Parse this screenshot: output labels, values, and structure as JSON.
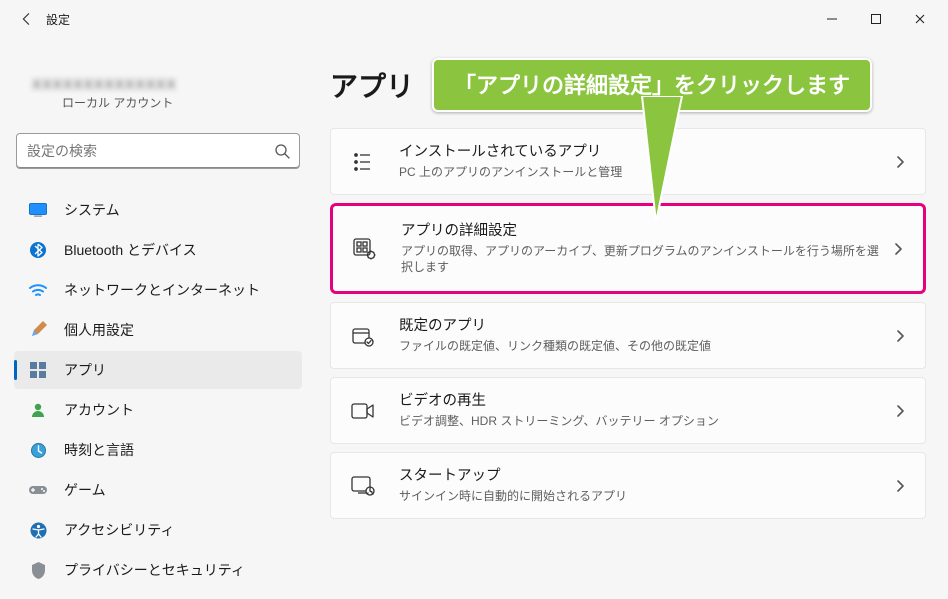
{
  "window": {
    "title": "設定"
  },
  "account": {
    "display_name": "XXXXXXXXXXXXXX",
    "type_label": "ローカル アカウント"
  },
  "search": {
    "placeholder": "設定の検索"
  },
  "sidebar": {
    "items": [
      {
        "label": "システム",
        "icon": "system"
      },
      {
        "label": "Bluetooth とデバイス",
        "icon": "bluetooth"
      },
      {
        "label": "ネットワークとインターネット",
        "icon": "network"
      },
      {
        "label": "個人用設定",
        "icon": "personalize"
      },
      {
        "label": "アプリ",
        "icon": "apps",
        "selected": true
      },
      {
        "label": "アカウント",
        "icon": "account"
      },
      {
        "label": "時刻と言語",
        "icon": "time"
      },
      {
        "label": "ゲーム",
        "icon": "gaming"
      },
      {
        "label": "アクセシビリティ",
        "icon": "accessibility"
      },
      {
        "label": "プライバシーとセキュリティ",
        "icon": "privacy"
      }
    ]
  },
  "page": {
    "title": "アプリ"
  },
  "callout": {
    "text": "「アプリの詳細設定」をクリックします"
  },
  "settings_items": [
    {
      "title": "インストールされているアプリ",
      "desc": "PC 上のアプリのアンインストールと管理",
      "icon": "installed-apps",
      "highlighted": false
    },
    {
      "title": "アプリの詳細設定",
      "desc": "アプリの取得、アプリのアーカイブ、更新プログラムのアンインストールを行う場所を選択します",
      "icon": "advanced-apps",
      "highlighted": true
    },
    {
      "title": "既定のアプリ",
      "desc": "ファイルの既定値、リンク種類の既定値、その他の既定値",
      "icon": "default-apps",
      "highlighted": false
    },
    {
      "title": "ビデオの再生",
      "desc": "ビデオ調整、HDR ストリーミング、バッテリー オプション",
      "icon": "video",
      "highlighted": false
    },
    {
      "title": "スタートアップ",
      "desc": "サインイン時に自動的に開始されるアプリ",
      "icon": "startup",
      "highlighted": false
    }
  ]
}
